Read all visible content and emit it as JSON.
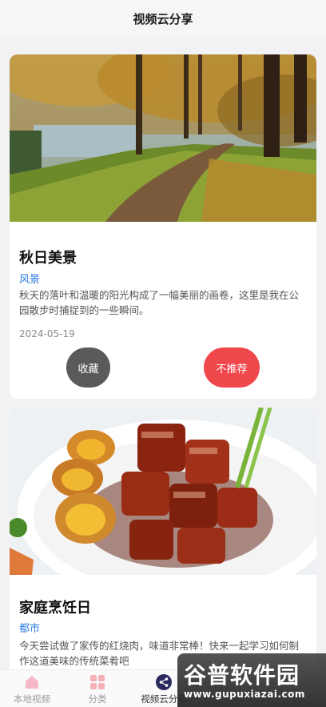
{
  "header": {
    "title": "视频云分享"
  },
  "posts": [
    {
      "title": "秋日美景",
      "category": "风景",
      "description": "秋天的落叶和温暖的阳光构成了一幅美丽的画卷，这里是我在公园散步时捕捉到的一些瞬间。",
      "date": "2024-05-19",
      "favorite_label": "收藏",
      "dislike_label": "不推荐"
    },
    {
      "title": "家庭烹饪日",
      "category": "都市",
      "description": "今天尝试做了家传的红烧肉，味道非常棒！快来一起学习如何制作这道美味的传统菜肴吧"
    }
  ],
  "tabbar": {
    "items": [
      {
        "label": "本地视频",
        "icon": "home-icon"
      },
      {
        "label": "分类",
        "icon": "grid-icon"
      },
      {
        "label": "视频云分享",
        "icon": "share-icon"
      }
    ],
    "active_index": 2
  },
  "watermark": {
    "logo": "谷普软件园",
    "url": "www.gupuxiazai.com"
  },
  "colors": {
    "accent_blue": "#2f7de1",
    "dislike_red": "#f0474d",
    "favorite_gray": "#5a5a5a"
  }
}
